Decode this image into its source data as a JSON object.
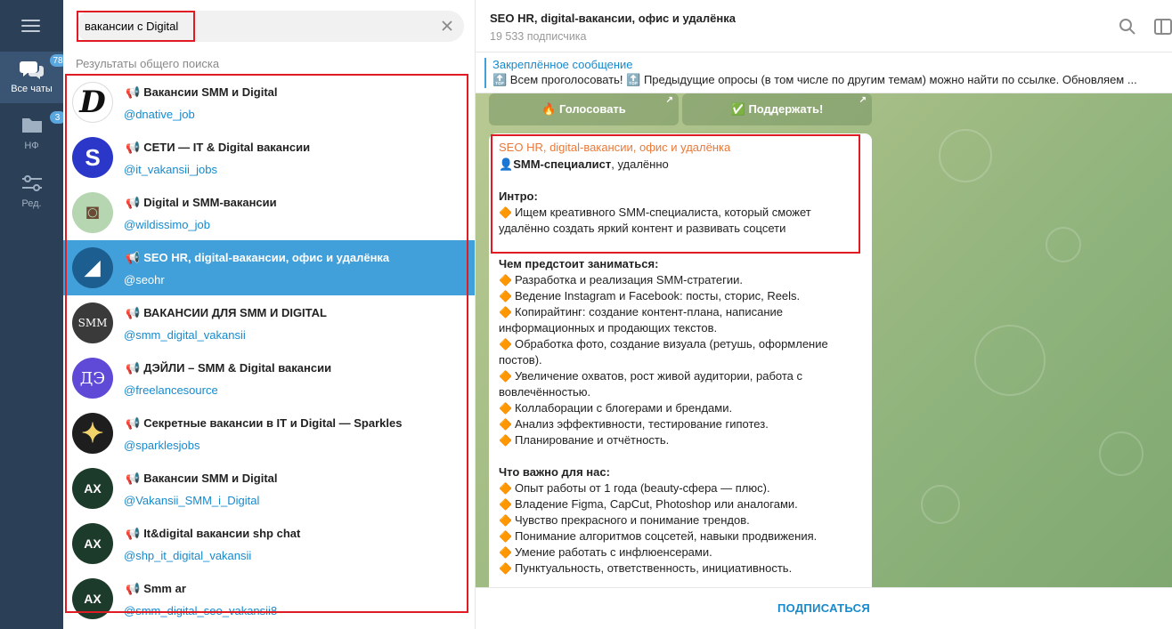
{
  "rail": {
    "folders": [
      {
        "label": "Все чаты",
        "badge": "78",
        "icon": "chats-icon"
      },
      {
        "label": "НФ",
        "badge": "3",
        "icon": "folder-icon"
      },
      {
        "label": "Ред.",
        "icon": "sliders-icon"
      }
    ]
  },
  "search": {
    "value": "вакансии с Digital",
    "section_label": "Результаты общего поиска"
  },
  "results": [
    {
      "title": "Вакансии SMM и Digital",
      "handle": "@dnative_job",
      "avatar_text": "D",
      "avatar_color": "#ffffff"
    },
    {
      "title": "СЕТИ — IT & Digital вакансии",
      "handle": "@it_vakansii_jobs",
      "avatar_text": "S",
      "avatar_color": "#2a37c9"
    },
    {
      "title": "Digital и SMM-вакансии",
      "handle": "@wildissimo_job",
      "avatar_text": "◙",
      "avatar_color": "#b5d6b0"
    },
    {
      "title": "SEO HR, digital-вакансии, офис и удалёнка",
      "handle": "@seohr",
      "avatar_text": "◢",
      "avatar_color": "#2c6a9b"
    },
    {
      "title": "ВАКАНСИИ ДЛЯ SMM И DIGITAL",
      "handle": "@smm_digital_vakansii",
      "avatar_text": "SMM",
      "avatar_color": "#3a3a3a"
    },
    {
      "title": "ДЭЙЛИ – SMM & Digital вакансии",
      "handle": "@freelancesource",
      "avatar_text": "ДЭ",
      "avatar_color": "#5f4ad8"
    },
    {
      "title": "Секретные вакансии в IT и Digital — Sparkles",
      "handle": "@sparklesjobs",
      "avatar_text": "✦",
      "avatar_color": "#1e1e1e"
    },
    {
      "title": "Вакансии SMM и Digital",
      "handle": "@Vakansii_SMM_i_Digital",
      "avatar_text": "АХ",
      "avatar_color": "#1d3b2a"
    },
    {
      "title": "It&digital вакансии shp chat",
      "handle": "@shp_it_digital_vakansii",
      "avatar_text": "АХ",
      "avatar_color": "#1d3b2a"
    },
    {
      "title": "Smm ar",
      "handle": "@smm_digital_seo_vakansii8",
      "avatar_text": "АХ",
      "avatar_color": "#1d3b2a"
    }
  ],
  "chat": {
    "title": "SEO HR, digital-вакансии, офис и удалёнка",
    "subscribers": "19 533 подписчика",
    "pinned_label": "Закреплённое сообщение",
    "pinned_text": "🔝 Всем проголосовать! 🔝  Предыдущие опросы (в том числе по другим темам) можно найти по ссылке. Обновляем ...",
    "vote_button": "🔥 Голосовать",
    "support_button": "✅ Поддержать!",
    "subscribe_label": "ПОДПИСАТЬСЯ"
  },
  "message": {
    "author": "SEO HR, digital-вакансии, офис и удалёнка",
    "role_bold": "SMM-специалист",
    "role_rest": ", удалённо",
    "intro_heading": "Интро:",
    "intro_text": "Ищем креативного SMM-специалиста, который сможет удалённо создать яркий контент и развивать соцсети",
    "tasks_heading": "Чем предстоит заниматься:",
    "tasks": [
      "Разработка и реализация SMM-стратегии.",
      "Ведение Instagram и Facebook: посты, сторис, Reels.",
      "Копирайтинг: создание контент-плана, написание информационных и продающих текстов.",
      "Обработка фото, создание визуала (ретушь, оформление постов).",
      "Увеличение охватов, рост живой аудитории, работа с вовлечённостью.",
      "Коллаборации с блогерами и брендами.",
      "Анализ эффективности, тестирование гипотез.",
      "Планирование и отчётность."
    ],
    "reqs_heading": "Что важно для нас:",
    "reqs": [
      "Опыт работы от 1 года (beauty-сфера — плюс).",
      "Владение Figma, CapCut, Photoshop или аналогами.",
      "Чувство прекрасного и понимание трендов.",
      "Понимание алгоритмов соцсетей, навыки продвижения.",
      "Умение работать с инфлюенсерами.",
      "Пунктуальность, ответственность, инициативность."
    ]
  },
  "colors": {
    "accent": "#419fd9",
    "link": "#168acd",
    "highlight_box": "#e01b24",
    "rail": "#2b3f56",
    "author": "#e87a3b"
  }
}
